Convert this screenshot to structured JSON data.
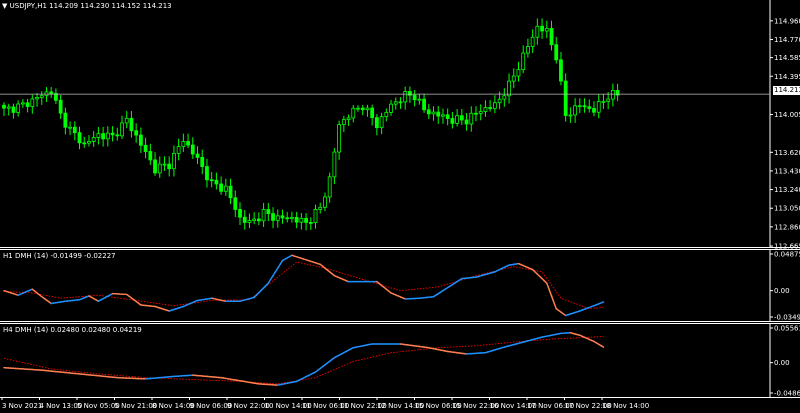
{
  "main_pane": {
    "title": "USDJPY,H1",
    "ohlc": "114.209 114.230 114.152 114.213",
    "price_ticks": [
      "114.960",
      "114.770",
      "114.585",
      "114.395",
      "114.005",
      "113.620",
      "113.430",
      "113.240",
      "113.050",
      "112.860",
      "112.665"
    ],
    "current_price": "114.213"
  },
  "sub_pane_1": {
    "title": "H1 DMH (14) -0.01499 -0.02227",
    "ticks": [
      "0.04875",
      "0.00",
      "-0.03499"
    ]
  },
  "sub_pane_2": {
    "title": "H4 DMH (14) 0.02480 0.02480 0.04219",
    "ticks": [
      "0.05561",
      "0.00",
      "-0.04861"
    ]
  },
  "time_axis": [
    "3 Nov 2021",
    "4 Nov 13:00",
    "5 Nov 05:00",
    "5 Nov 21:00",
    "8 Nov 14:00",
    "9 Nov 06:00",
    "9 Nov 22:00",
    "10 Nov 14:00",
    "11 Nov 06:00",
    "11 Nov 22:00",
    "12 Nov 14:00",
    "15 Nov 06:00",
    "15 Nov 22:00",
    "16 Nov 14:00",
    "17 Nov 06:00",
    "17 Nov 22:00",
    "18 Nov 14:00"
  ],
  "colors": {
    "background": "#000000",
    "candle": "#00ff00",
    "price_line": "#c0c0c0",
    "dmh_up": "#1e90ff",
    "dmh_down": "#ff7f50",
    "signal": "#ff0000"
  },
  "chart_data": [
    {
      "type": "candlestick",
      "title": "USDJPY,H1",
      "y_range": [
        112.665,
        115.05
      ],
      "close_path": [
        [
          0,
          114.05
        ],
        [
          4,
          114.1
        ],
        [
          8,
          114.2
        ],
        [
          10,
          114.25
        ],
        [
          12,
          114.0
        ],
        [
          14,
          113.85
        ],
        [
          17,
          113.7
        ],
        [
          20,
          113.8
        ],
        [
          23,
          113.78
        ],
        [
          26,
          113.95
        ],
        [
          29,
          113.7
        ],
        [
          32,
          113.45
        ],
        [
          35,
          113.5
        ],
        [
          38,
          113.75
        ],
        [
          41,
          113.55
        ],
        [
          44,
          113.3
        ],
        [
          47,
          113.25
        ],
        [
          50,
          112.95
        ],
        [
          52,
          112.9
        ],
        [
          55,
          113.0
        ],
        [
          58,
          112.95
        ],
        [
          61,
          112.95
        ],
        [
          64,
          112.9
        ],
        [
          67,
          113.05
        ],
        [
          69,
          113.35
        ],
        [
          71,
          113.9
        ],
        [
          73,
          114.0
        ],
        [
          76,
          114.1
        ],
        [
          79,
          113.9
        ],
        [
          82,
          114.1
        ],
        [
          85,
          114.2
        ],
        [
          87,
          114.2
        ],
        [
          89,
          114.05
        ],
        [
          92,
          114.0
        ],
        [
          95,
          113.95
        ],
        [
          98,
          113.95
        ],
        [
          101,
          114.05
        ],
        [
          104,
          114.1
        ],
        [
          107,
          114.3
        ],
        [
          110,
          114.6
        ],
        [
          113,
          114.9
        ],
        [
          115,
          114.85
        ],
        [
          117,
          114.6
        ],
        [
          119,
          114.0
        ],
        [
          122,
          114.1
        ],
        [
          125,
          114.05
        ],
        [
          128,
          114.2
        ],
        [
          130,
          114.21
        ]
      ]
    },
    {
      "type": "line",
      "title": "H1 DMH (14) -0.01499 -0.02227",
      "y_range": [
        -0.03499,
        0.04875
      ],
      "series": [
        {
          "values": [
            [
              0,
              0.0
            ],
            [
              3,
              -0.006
            ],
            [
              6,
              0.002
            ],
            [
              8,
              -0.008
            ],
            [
              10,
              -0.017
            ],
            [
              13,
              -0.014
            ],
            [
              16,
              -0.012
            ],
            [
              18,
              -0.007
            ],
            [
              20,
              -0.014
            ],
            [
              23,
              -0.004
            ],
            [
              26,
              -0.005
            ],
            [
              29,
              -0.019
            ],
            [
              32,
              -0.021
            ],
            [
              35,
              -0.027
            ],
            [
              38,
              -0.021
            ],
            [
              41,
              -0.013
            ],
            [
              44,
              -0.01
            ],
            [
              47,
              -0.014
            ],
            [
              50,
              -0.014
            ],
            [
              53,
              -0.009
            ],
            [
              56,
              0.01
            ],
            [
              59,
              0.04
            ],
            [
              61,
              0.047
            ],
            [
              64,
              0.041
            ],
            [
              67,
              0.035
            ],
            [
              70,
              0.02
            ],
            [
              73,
              0.012
            ],
            [
              76,
              0.012
            ],
            [
              79,
              0.012
            ],
            [
              82,
              -0.003
            ],
            [
              85,
              -0.011
            ],
            [
              88,
              -0.01
            ],
            [
              91,
              -0.008
            ],
            [
              94,
              0.004
            ],
            [
              97,
              0.016
            ],
            [
              100,
              0.018
            ],
            [
              104,
              0.025
            ],
            [
              107,
              0.034
            ],
            [
              109,
              0.036
            ],
            [
              112,
              0.028
            ],
            [
              115,
              0.01
            ],
            [
              117,
              -0.024
            ],
            [
              119,
              -0.033
            ],
            [
              122,
              -0.027
            ],
            [
              125,
              -0.02
            ],
            [
              127,
              -0.015
            ]
          ]
        },
        {
          "values": [
            [
              0,
              -0.001
            ],
            [
              6,
              -0.003
            ],
            [
              12,
              -0.01
            ],
            [
              20,
              -0.006
            ],
            [
              28,
              -0.013
            ],
            [
              36,
              -0.02
            ],
            [
              44,
              -0.013
            ],
            [
              52,
              -0.012
            ],
            [
              58,
              0.018
            ],
            [
              62,
              0.038
            ],
            [
              68,
              0.03
            ],
            [
              76,
              0.015
            ],
            [
              84,
              0.0
            ],
            [
              92,
              0.005
            ],
            [
              100,
              0.02
            ],
            [
              108,
              0.032
            ],
            [
              114,
              0.025
            ],
            [
              118,
              -0.01
            ],
            [
              124,
              -0.024
            ],
            [
              127,
              -0.022
            ]
          ]
        }
      ]
    },
    {
      "type": "line",
      "title": "H4 DMH (14) 0.02480 0.02480 0.04219",
      "y_range": [
        -0.04861,
        0.05561
      ],
      "series": [
        {
          "values": [
            [
              0,
              -0.008
            ],
            [
              8,
              -0.012
            ],
            [
              16,
              -0.018
            ],
            [
              24,
              -0.024
            ],
            [
              30,
              -0.026
            ],
            [
              36,
              -0.022
            ],
            [
              40,
              -0.02
            ],
            [
              46,
              -0.024
            ],
            [
              54,
              -0.034
            ],
            [
              58,
              -0.036
            ],
            [
              62,
              -0.03
            ],
            [
              66,
              -0.015
            ],
            [
              70,
              0.008
            ],
            [
              74,
              0.024
            ],
            [
              78,
              0.03
            ],
            [
              84,
              0.03
            ],
            [
              90,
              0.024
            ],
            [
              94,
              0.018
            ],
            [
              98,
              0.014
            ],
            [
              102,
              0.016
            ],
            [
              106,
              0.025
            ],
            [
              110,
              0.033
            ],
            [
              114,
              0.041
            ],
            [
              118,
              0.047
            ],
            [
              120,
              0.048
            ],
            [
              122,
              0.044
            ],
            [
              125,
              0.034
            ],
            [
              127,
              0.025
            ]
          ]
        },
        {
          "values": [
            [
              0,
              0.007
            ],
            [
              10,
              -0.01
            ],
            [
              20,
              -0.018
            ],
            [
              30,
              -0.024
            ],
            [
              40,
              -0.027
            ],
            [
              50,
              -0.03
            ],
            [
              58,
              -0.034
            ],
            [
              66,
              -0.024
            ],
            [
              74,
              0.002
            ],
            [
              82,
              0.016
            ],
            [
              92,
              0.024
            ],
            [
              100,
              0.027
            ],
            [
              108,
              0.033
            ],
            [
              116,
              0.038
            ],
            [
              122,
              0.04
            ],
            [
              127,
              0.042
            ]
          ]
        }
      ]
    }
  ]
}
